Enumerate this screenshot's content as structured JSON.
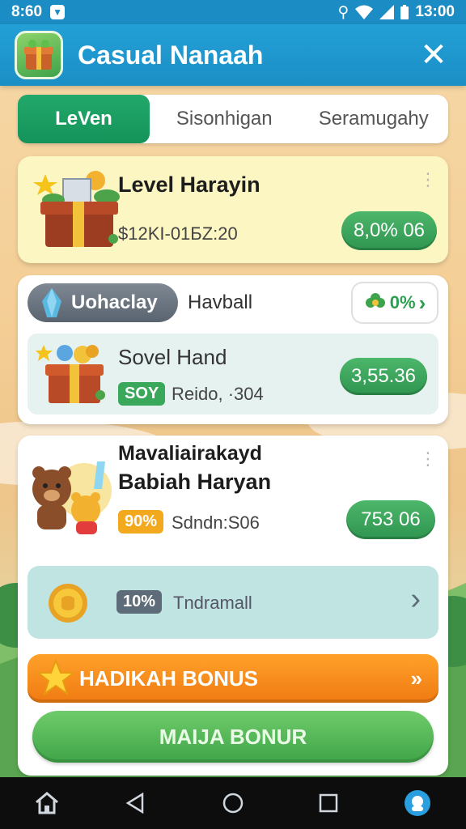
{
  "status_bar": {
    "time_left": "8:60",
    "time_right": "13:00"
  },
  "app_bar": {
    "title": "Casual Nanaah",
    "close_label": "✕"
  },
  "tabs": [
    {
      "label": "LeVen",
      "active": true
    },
    {
      "label": "Sisonhigan",
      "active": false
    },
    {
      "label": "Seramugahy",
      "active": false
    }
  ],
  "card1": {
    "title": "Level Harayin",
    "subtitle": "$12KI-01БZ:20",
    "button": "8,0% 06"
  },
  "card2": {
    "feature_label": "Uohaclay",
    "feature_name": "Havball",
    "reward_label": "0%",
    "item_title": "Sovel Hand",
    "badge": "SOY",
    "item_subtitle": "Reido, ·304",
    "button": "3,55.36"
  },
  "card3": {
    "title_line1": "Mavaliairakayd",
    "title_line2": "Babiah Haryan",
    "badge": "90%",
    "subtitle": "Sdndn:S06",
    "button": "753 06",
    "row_badge": "10%",
    "row_label": "Tndramall",
    "bonus_label": "HADIKAH BONUS",
    "bonus_arrow": "»",
    "claim_label": "MAIJA BONUR"
  },
  "colors": {
    "accent_green": "#2f9550",
    "header_blue": "#1c8dc4",
    "bonus_orange": "#f07a12"
  }
}
